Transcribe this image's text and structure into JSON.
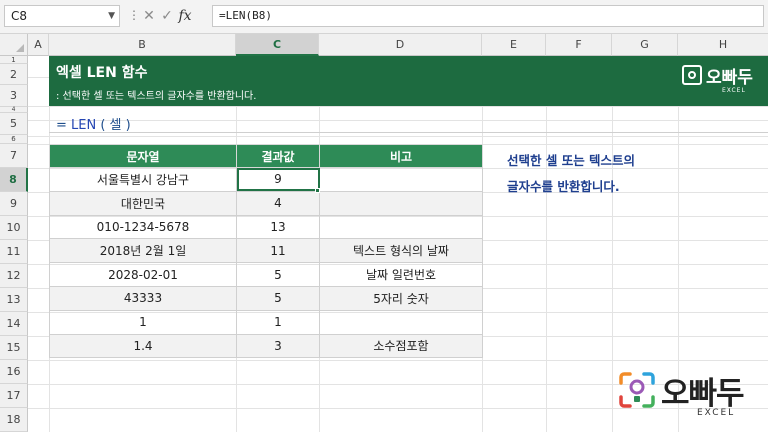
{
  "formula_bar": {
    "name_box": "C8",
    "separator": "⋮",
    "cancel_icon": "✕",
    "enter_icon": "✓",
    "fx_label": "fx",
    "formula": "=LEN(B8)"
  },
  "columns": [
    "A",
    "B",
    "C",
    "D",
    "E",
    "F",
    "G",
    "H"
  ],
  "rows": [
    "1",
    "2",
    "3",
    "4",
    "5",
    "6",
    "7",
    "8",
    "9",
    "10",
    "11",
    "12",
    "13",
    "14",
    "15",
    "16",
    "17",
    "18"
  ],
  "banner": {
    "title": "엑셀 LEN 함수",
    "subtitle": ":  선택한 셀 또는 텍스트의 글자수를 반환합니다.",
    "logo_name": "오빠두",
    "logo_sub": "EXCEL",
    "color": "#1d6b40"
  },
  "syntax": {
    "prefix": "= ",
    "function": "LEN",
    "args": " ( 셀 )"
  },
  "table": {
    "headers": [
      "문자열",
      "결과값",
      "비고"
    ],
    "rows": [
      {
        "text": "서울특별시 강남구",
        "result": "9",
        "note": ""
      },
      {
        "text": "대한민국",
        "result": "4",
        "note": ""
      },
      {
        "text": "010-1234-5678",
        "result": "13",
        "note": ""
      },
      {
        "text": "2018년 2월 1일",
        "result": "11",
        "note": "텍스트 형식의 날짜"
      },
      {
        "text": "2028-02-01",
        "result": "5",
        "note": "날짜 일련번호"
      },
      {
        "text": "43333",
        "result": "5",
        "note": "5자리 숫자"
      },
      {
        "text": "1",
        "result": "1",
        "note": ""
      },
      {
        "text": "1.4",
        "result": "3",
        "note": "소수점포함"
      }
    ],
    "header_color": "#2e8b57"
  },
  "note": {
    "line1": "선택한 셀 또는 텍스트의",
    "line2": "글자수를 반환합니다."
  },
  "bottom_logo": {
    "name": "오빠두",
    "sub": "EXCEL"
  },
  "active_cell": "C8",
  "accent": "#217346"
}
